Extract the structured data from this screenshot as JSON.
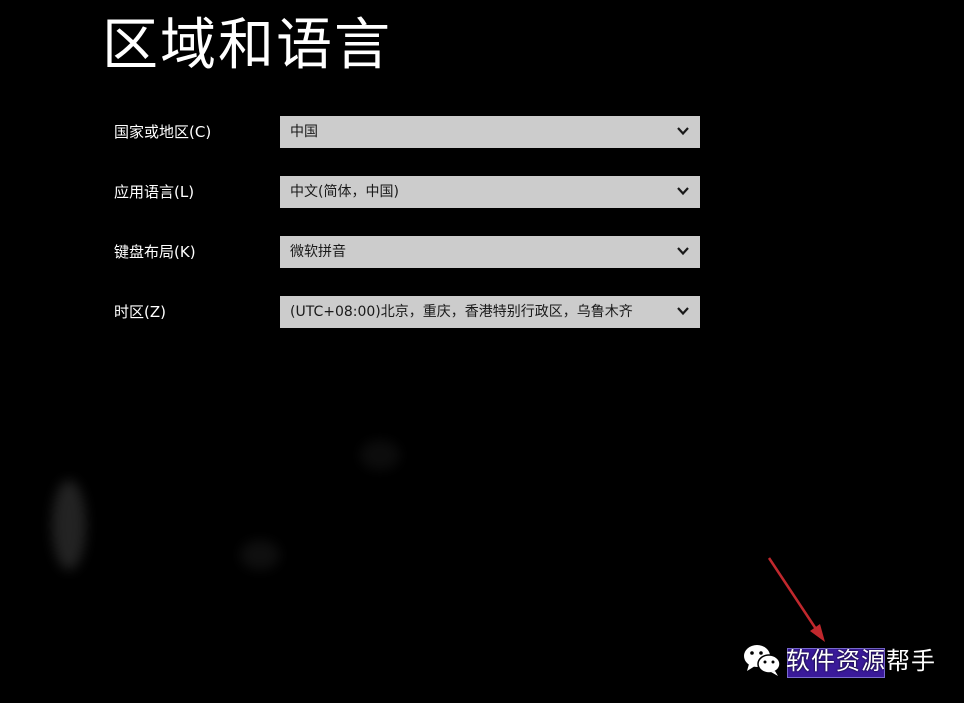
{
  "page": {
    "title": "区域和语言"
  },
  "form": {
    "rows": [
      {
        "label": "国家或地区(C)",
        "value": "中国"
      },
      {
        "label": "应用语言(L)",
        "value": "中文(简体，中国)"
      },
      {
        "label": "键盘布局(K)",
        "value": "微软拼音"
      },
      {
        "label": "时区(Z)",
        "value": "(UTC+08:00)北京，重庆，香港特别行政区，乌鲁木齐"
      }
    ]
  },
  "icons": {
    "dropdown": "chevron-down-icon",
    "watermark": "wechat-icon"
  },
  "watermark": {
    "text": "软件资源帮手"
  },
  "colors": {
    "background": "#000000",
    "select_background": "#cccccc",
    "button_accent": "#3a1a9a",
    "arrow": "#c0282d"
  }
}
